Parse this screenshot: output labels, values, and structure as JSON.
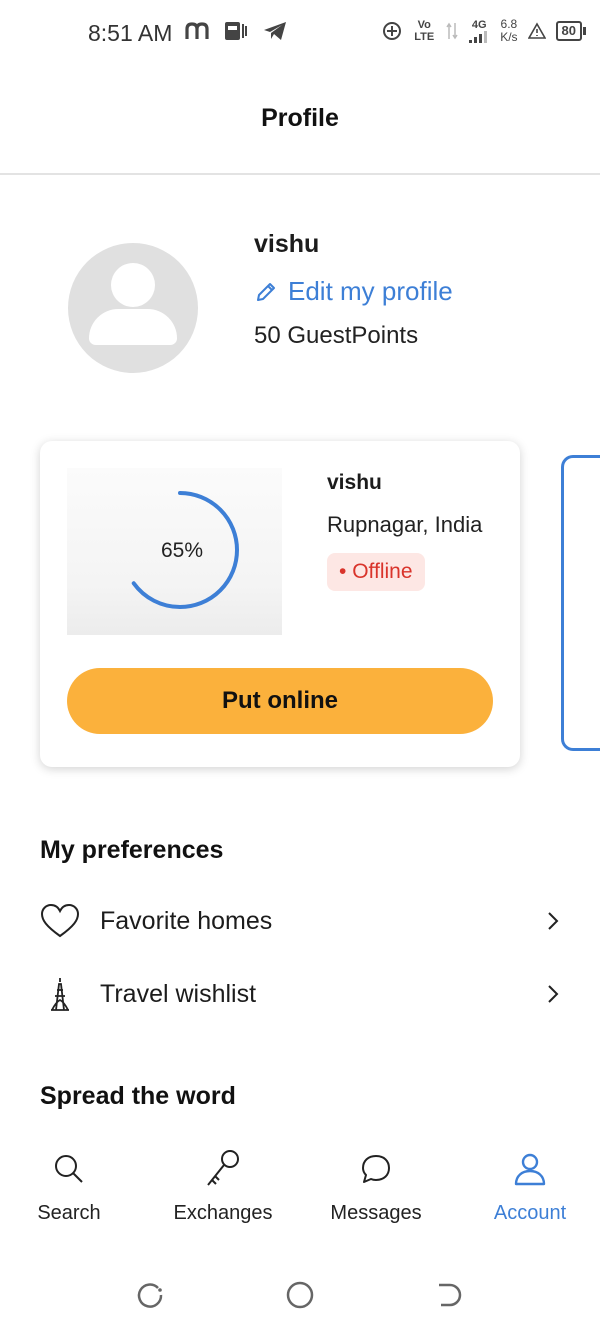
{
  "status_bar": {
    "time": "8:51 AM",
    "left_icons": [
      "m-app-icon",
      "paytm-icon",
      "telegram-icon"
    ],
    "network": "Vo LTE",
    "signal": "4G",
    "speed": "6.8",
    "speed_unit": "K/s",
    "battery": "80"
  },
  "header": {
    "title": "Profile"
  },
  "profile": {
    "name": "vishu",
    "edit_label": "Edit my profile",
    "guest_points": "50 GuestPoints"
  },
  "listing_card": {
    "completion": "65%",
    "completion_fraction": 0.65,
    "name": "vishu",
    "location": "Rupnagar, India",
    "status": "Offline",
    "action_label": "Put online"
  },
  "preferences": {
    "title": "My preferences",
    "items": [
      {
        "label": "Favorite homes",
        "icon": "heart-icon"
      },
      {
        "label": "Travel wishlist",
        "icon": "eiffel-tower-icon"
      }
    ]
  },
  "spread": {
    "title": "Spread the word"
  },
  "bottom_nav": {
    "items": [
      {
        "label": "Search",
        "icon": "search-icon"
      },
      {
        "label": "Exchanges",
        "icon": "key-icon"
      },
      {
        "label": "Messages",
        "icon": "chat-bubble-icon"
      },
      {
        "label": "Account",
        "icon": "person-icon",
        "active": true
      }
    ]
  },
  "colors": {
    "accent": "#3d7fd6",
    "button": "#fbb13c",
    "offline_bg": "#fde7e4",
    "offline_text": "#d9342b"
  }
}
